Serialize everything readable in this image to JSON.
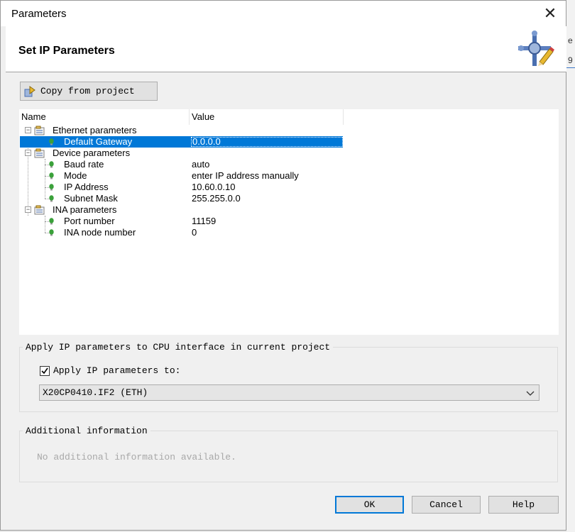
{
  "window": {
    "title": "Parameters"
  },
  "header": {
    "title": "Set IP Parameters",
    "icon": "settings-tools-icon"
  },
  "toolbar": {
    "copy_label": "Copy from project"
  },
  "tree": {
    "columns": [
      "Name",
      "Value"
    ],
    "groups": [
      {
        "name": "Ethernet parameters",
        "items": [
          {
            "name": "Default Gateway",
            "value": "0.0.0.0",
            "selected": true
          }
        ]
      },
      {
        "name": "Device parameters",
        "items": [
          {
            "name": "Baud rate",
            "value": "auto"
          },
          {
            "name": "Mode",
            "value": "enter IP address manually"
          },
          {
            "name": "IP Address",
            "value": "10.60.0.10"
          },
          {
            "name": "Subnet Mask",
            "value": "255.255.0.0"
          }
        ]
      },
      {
        "name": "INA parameters",
        "items": [
          {
            "name": "Port number",
            "value": "11159"
          },
          {
            "name": "INA node number",
            "value": "0"
          }
        ]
      }
    ]
  },
  "apply": {
    "legend": "Apply IP parameters to CPU interface in current project",
    "checkbox_label": "Apply IP parameters to:",
    "checked": true,
    "selected_interface": "X20CP0410.IF2 (ETH)"
  },
  "additional": {
    "legend": "Additional information",
    "text": "No additional information available."
  },
  "buttons": {
    "ok": "OK",
    "cancel": "Cancel",
    "help": "Help"
  },
  "colors": {
    "selection": "#0078d7",
    "bulb": "#3aa13a"
  }
}
